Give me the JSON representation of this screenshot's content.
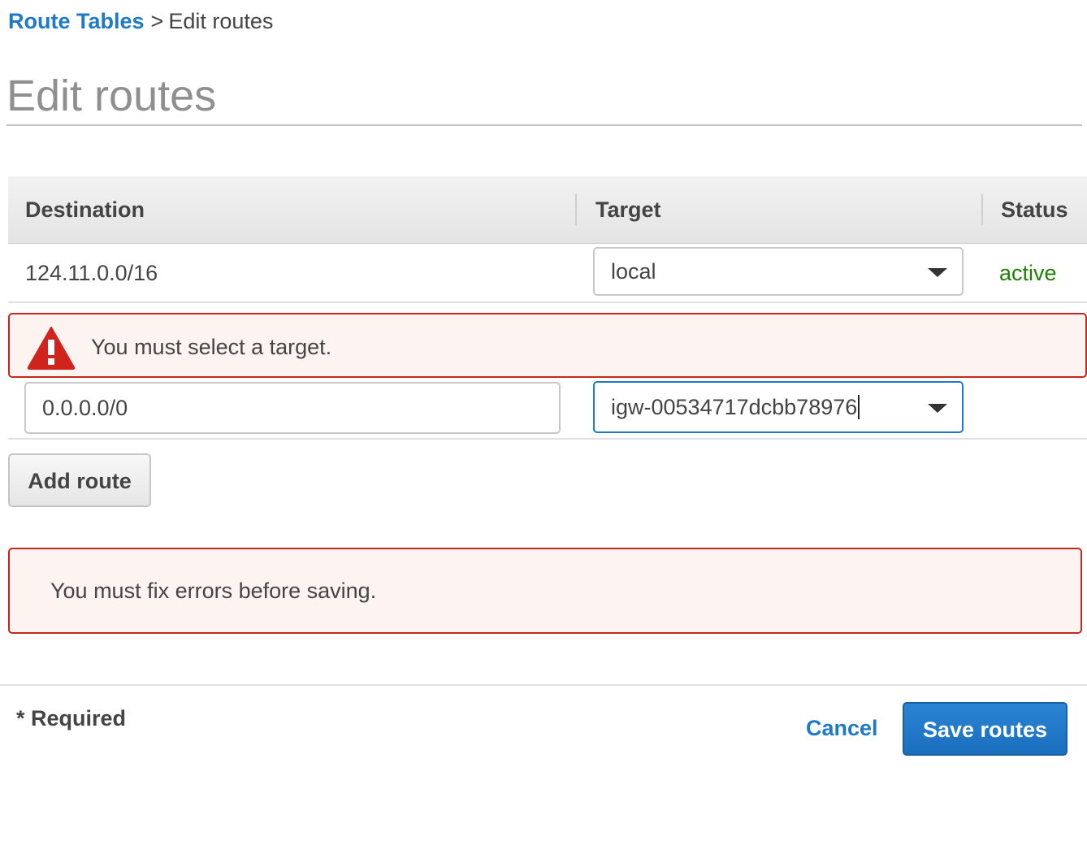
{
  "breadcrumb": {
    "parent_label": "Route Tables",
    "separator": ">",
    "current_label": "Edit routes"
  },
  "page_title": "Edit routes",
  "table": {
    "columns": {
      "destination": "Destination",
      "target": "Target",
      "status": "Status"
    },
    "rows": [
      {
        "destination": "124.11.0.0/16",
        "target": "local",
        "status": "active",
        "status_color": "#1d8102"
      },
      {
        "destination": "0.0.0.0/0",
        "target": "igw-00534717dcbb78976",
        "status": ""
      }
    ],
    "row_alert": {
      "message": "You must select a target.",
      "icon": "warning-triangle-icon"
    }
  },
  "add_route_label": "Add route",
  "form_error": {
    "message": "You must fix errors before saving."
  },
  "footer": {
    "required_note": "* Required",
    "cancel_label": "Cancel",
    "save_label": "Save routes"
  },
  "colors": {
    "link": "#1f79c8",
    "error_border": "#c4281c",
    "error_bg": "#fdf3f1",
    "primary": "#1f79c8",
    "status_active": "#1d8102"
  }
}
